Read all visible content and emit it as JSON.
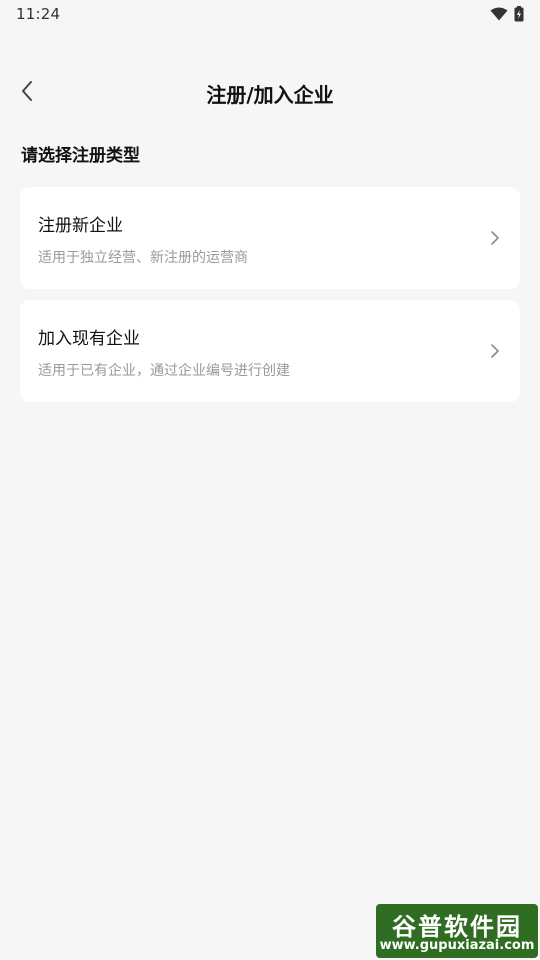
{
  "status_bar": {
    "time": "11:24",
    "icons": [
      "wifi-icon",
      "battery-charging-icon"
    ]
  },
  "header": {
    "title": "注册/加入企业",
    "back_icon": "chevron-left-icon"
  },
  "section": {
    "label": "请选择注册类型"
  },
  "options": [
    {
      "title": "注册新企业",
      "description": "适用于独立经营、新注册的运营商",
      "icon": "chevron-right-icon"
    },
    {
      "title": "加入现有企业",
      "description": "适用于已有企业，通过企业编号进行创建",
      "icon": "chevron-right-icon"
    }
  ],
  "watermark": {
    "name": "谷普软件园",
    "url": "www.gupuxiazai.com",
    "color": "#2f6e22"
  }
}
